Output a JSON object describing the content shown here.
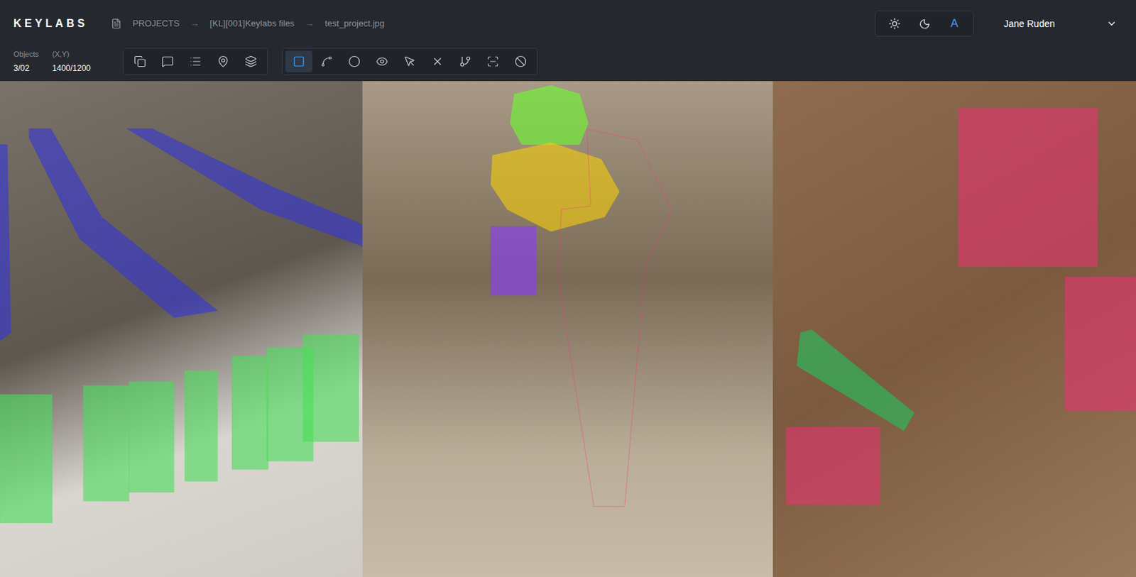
{
  "app": {
    "logo": "KEYLABS"
  },
  "breadcrumbs": {
    "separator": "→",
    "items": [
      {
        "label": "PROJECTS"
      },
      {
        "label": "[KL][001]Keylabs files"
      },
      {
        "label": "test_project.jpg"
      }
    ]
  },
  "theme": [
    {
      "kind": "sun",
      "label": "",
      "selected": false
    },
    {
      "kind": "moon",
      "label": "",
      "selected": false
    },
    {
      "kind": "auto",
      "label": "A",
      "selected": true
    }
  ],
  "user": {
    "name": "Jane Ruden"
  },
  "stats": [
    {
      "label": "Objects",
      "value": "3/02"
    },
    {
      "label": "(X,Y)",
      "value": "1400/1200"
    }
  ],
  "toolbars": [
    {
      "tools": [
        {
          "kind": "copy",
          "selected": false
        },
        {
          "kind": "comment",
          "selected": false
        },
        {
          "kind": "list",
          "selected": false
        },
        {
          "kind": "pin",
          "selected": false
        },
        {
          "kind": "layers",
          "selected": false
        }
      ]
    },
    {
      "tools": [
        {
          "kind": "box",
          "selected": true
        },
        {
          "kind": "points",
          "selected": false
        },
        {
          "kind": "circle",
          "selected": false
        },
        {
          "kind": "eye",
          "selected": false
        },
        {
          "kind": "pointer",
          "selected": false
        },
        {
          "kind": "close",
          "selected": false
        },
        {
          "kind": "tree",
          "selected": false
        },
        {
          "kind": "scan",
          "selected": false
        },
        {
          "kind": "ban",
          "selected": false
        }
      ]
    }
  ],
  "images": [
    {
      "annotations": [
        {
          "kind": "fill",
          "color": "#3535d8"
        },
        {
          "kind": "fill",
          "color": "#3535d8"
        },
        {
          "kind": "fill",
          "color": "#3535d8"
        },
        {
          "kind": "fill",
          "color": "#4ade5a"
        },
        {
          "kind": "fill",
          "color": "#4ade5a"
        },
        {
          "kind": "fill",
          "color": "#4ade5a"
        },
        {
          "kind": "fill",
          "color": "#4ade5a"
        },
        {
          "kind": "fill",
          "color": "#4ade5a"
        },
        {
          "kind": "fill",
          "color": "#4ade5a"
        },
        {
          "kind": "fill",
          "color": "#4ade5a"
        }
      ]
    },
    {
      "annotations": [
        {
          "kind": "fill",
          "color": "#6cff2e"
        },
        {
          "kind": "fill",
          "color": "#f5cf0a"
        },
        {
          "kind": "fill",
          "color": "#8b3bff"
        },
        {
          "kind": "outline",
          "color": "#ff2d8a"
        }
      ]
    },
    {
      "annotations": [
        {
          "kind": "fill",
          "color": "#e8336f"
        },
        {
          "kind": "fill",
          "color": "#e8336f"
        },
        {
          "kind": "fill",
          "color": "#e8336f"
        },
        {
          "kind": "fill",
          "color": "#22c55e"
        }
      ]
    }
  ]
}
